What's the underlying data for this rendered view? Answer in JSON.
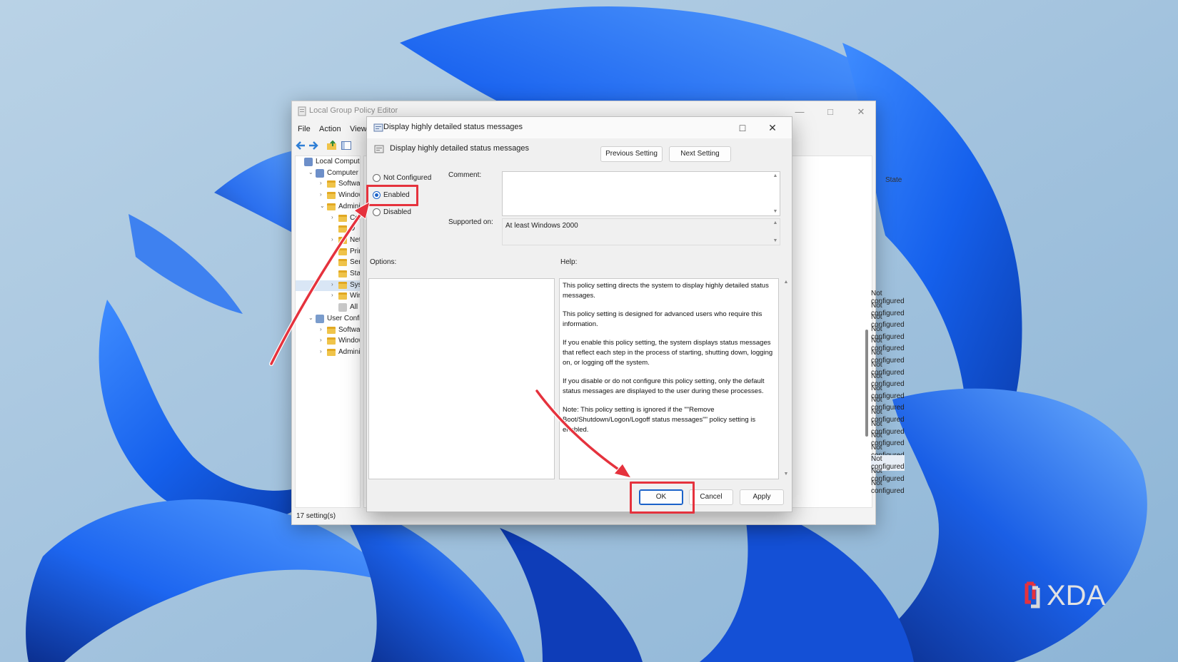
{
  "colors": {
    "accent": "#1a62c9",
    "annotation": "#e5323d",
    "wallpaper_bg": "#9cc0dc",
    "bloom_blue": "#1f6df0"
  },
  "gpe_window": {
    "title": "Local Group Policy Editor",
    "menu": [
      "File",
      "Action",
      "View"
    ],
    "toolbar_icons": [
      "back-arrow-icon",
      "forward-arrow-icon",
      "up-folder-icon",
      "show-hide-tree-icon"
    ],
    "tree": [
      {
        "label": "Local Computer P",
        "level": 0,
        "icon": "computer-icon",
        "chevron": ""
      },
      {
        "label": "Computer Co",
        "level": 1,
        "icon": "computer-icon",
        "chevron": "v"
      },
      {
        "label": "Software",
        "level": 2,
        "icon": "folder-icon",
        "chevron": ">"
      },
      {
        "label": "Windows",
        "level": 2,
        "icon": "folder-icon",
        "chevron": ">"
      },
      {
        "label": "Administ...",
        "level": 2,
        "icon": "folder-icon",
        "chevron": "v"
      },
      {
        "label": "Cont",
        "level": 3,
        "icon": "folder-icon",
        "chevron": ">"
      },
      {
        "label": "D",
        "level": 3,
        "icon": "folder-icon",
        "chevron": ""
      },
      {
        "label": "Netwo",
        "level": 3,
        "icon": "folder-icon",
        "chevron": ">"
      },
      {
        "label": "Printer",
        "level": 3,
        "icon": "folder-icon",
        "chevron": ""
      },
      {
        "label": "Server",
        "level": 3,
        "icon": "folder-icon",
        "chevron": ""
      },
      {
        "label": "Start M",
        "level": 3,
        "icon": "folder-icon",
        "chevron": ""
      },
      {
        "label": "System",
        "level": 3,
        "icon": "folder-icon",
        "chevron": ">",
        "selected": true
      },
      {
        "label": "Windo",
        "level": 3,
        "icon": "folder-icon",
        "chevron": ">"
      },
      {
        "label": "All Set",
        "level": 3,
        "icon": "settings-icon",
        "chevron": ""
      },
      {
        "label": "User Configur",
        "level": 1,
        "icon": "user-icon",
        "chevron": "v"
      },
      {
        "label": "Software S",
        "level": 2,
        "icon": "folder-icon",
        "chevron": ">"
      },
      {
        "label": "Windows",
        "level": 2,
        "icon": "folder-icon",
        "chevron": ">"
      },
      {
        "label": "Administra",
        "level": 2,
        "icon": "folder-icon",
        "chevron": ">"
      }
    ],
    "state_header": "State",
    "states": [
      "Not configured",
      "Not configured",
      "Not configured",
      "Not configured",
      "Not configured",
      "Not configured",
      "Not configured",
      "Not configured",
      "Not configured",
      "Not configured",
      "Not configured",
      "Not configured",
      "Not configured",
      "Not configured",
      "Not configured",
      "Not configured",
      "Not configured"
    ],
    "status": "17 setting(s)"
  },
  "dialog": {
    "title": "Display highly detailed status messages",
    "policy_name": "Display highly detailed status messages",
    "prev_button": "Previous Setting",
    "next_button": "Next Setting",
    "radio": {
      "not_configured": "Not Configured",
      "enabled": "Enabled",
      "disabled": "Disabled",
      "selected": "Enabled"
    },
    "comment_label": "Comment:",
    "comment_value": "",
    "supported_label": "Supported on:",
    "supported_value": "At least Windows 2000",
    "options_label": "Options:",
    "help_label": "Help:",
    "help_paragraphs": [
      "This policy setting directs the system to display highly detailed status messages.",
      "This policy setting is designed for advanced users who require this information.",
      "If you enable this policy setting, the system displays status messages that reflect each step in the process of starting, shutting down, logging on, or logging off the system.",
      "If you disable or do not configure this policy setting, only the default status messages are displayed to the user during these processes.",
      "Note: This policy setting is ignored if the \"\"Remove Boot/Shutdown/Logon/Logoff status messages\"\" policy setting is enabled."
    ],
    "ok_button": "OK",
    "cancel_button": "Cancel",
    "apply_button": "Apply"
  },
  "watermark": "XDA"
}
